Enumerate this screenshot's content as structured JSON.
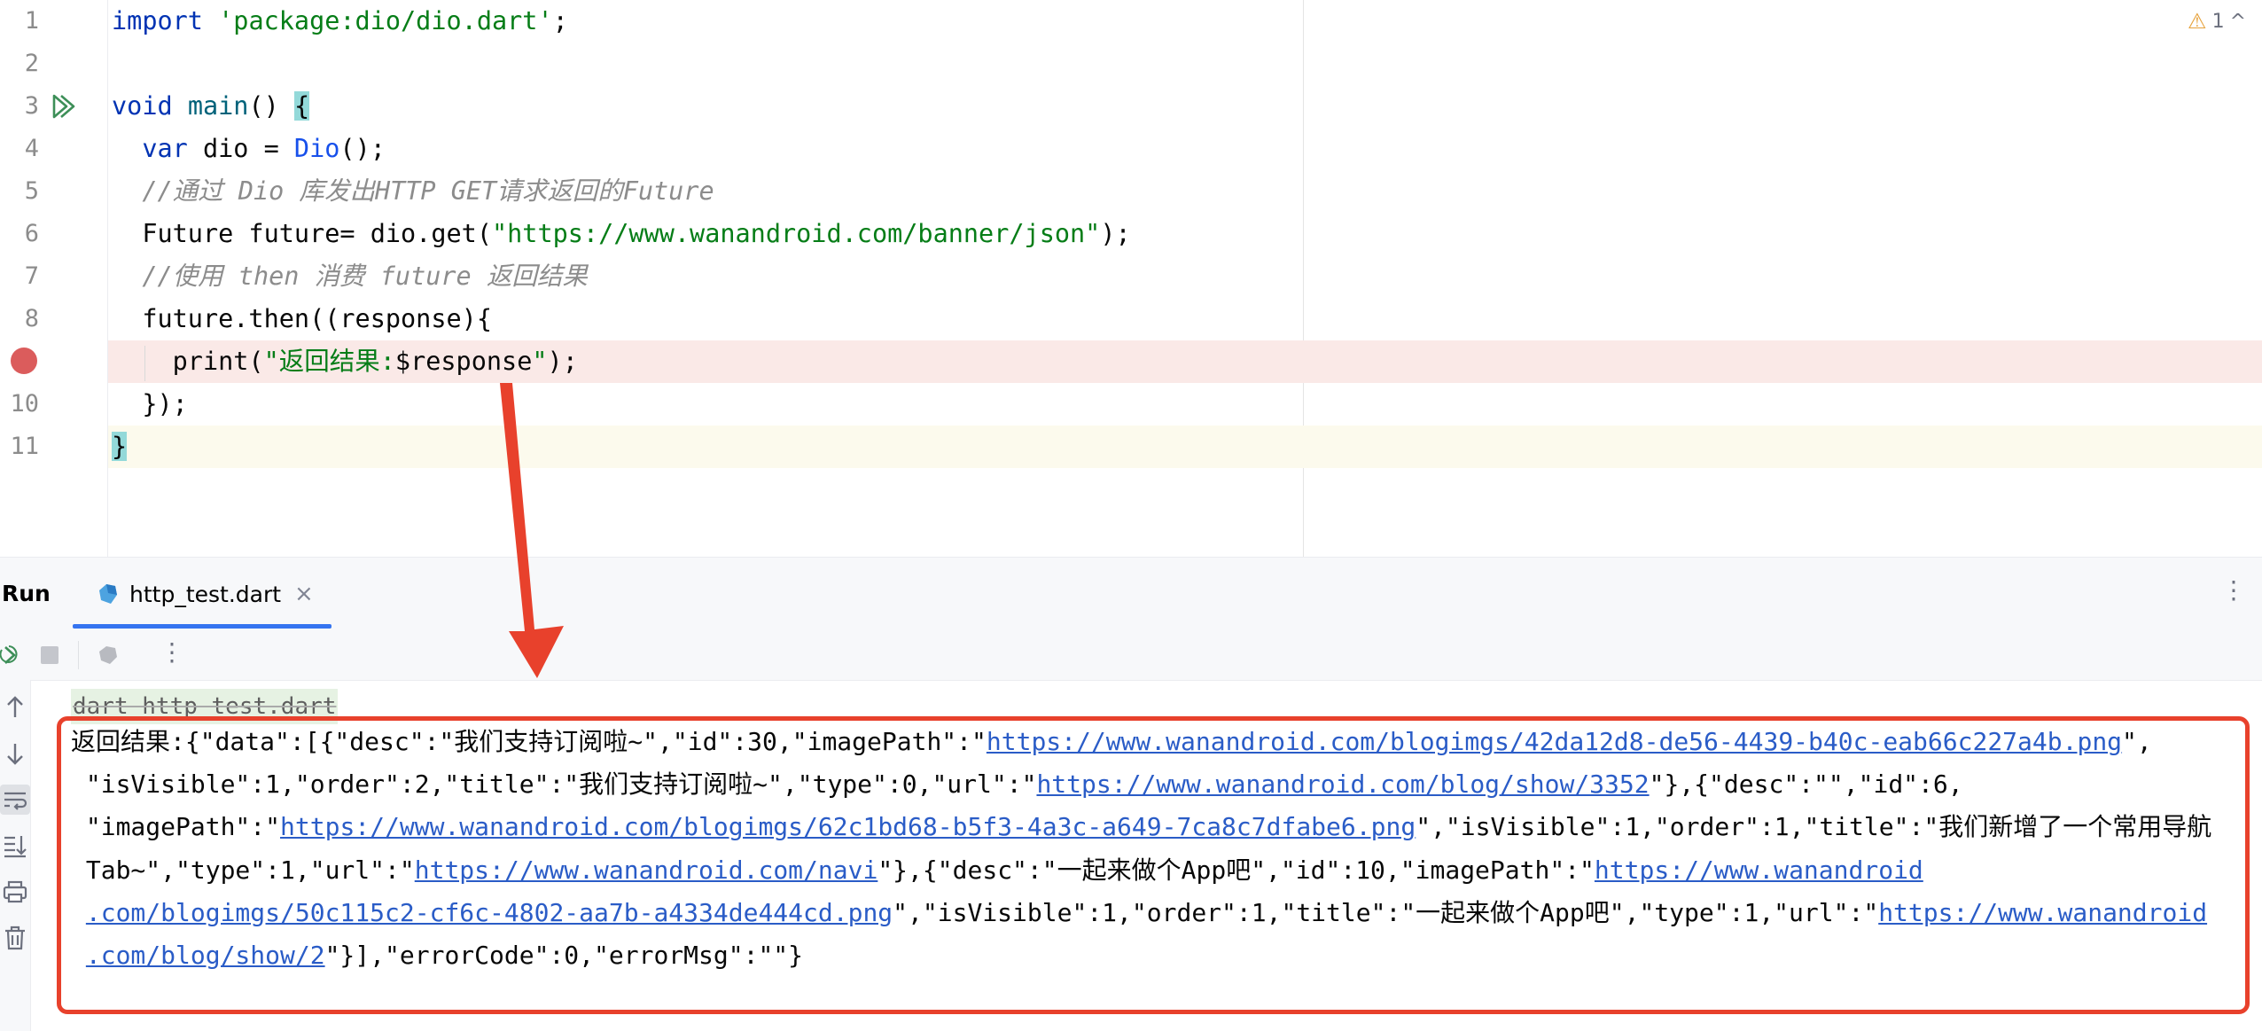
{
  "editor": {
    "lines": [
      {
        "num": "1"
      },
      {
        "num": "2"
      },
      {
        "num": "3"
      },
      {
        "num": "4"
      },
      {
        "num": "5"
      },
      {
        "num": "6"
      },
      {
        "num": "7"
      },
      {
        "num": "8"
      },
      {
        "num": ""
      },
      {
        "num": "10"
      },
      {
        "num": "11"
      }
    ],
    "code": {
      "l1_kw": "import",
      "l1_str": "'package:dio/dio.dart'",
      "l1_end": ";",
      "l3_kw": "void",
      "l3_fn": "main",
      "l3_paren": "() ",
      "l3_brace": "{",
      "l4_kw": "var",
      "l4_mid": " dio = ",
      "l4_cls": "Dio",
      "l4_end": "();",
      "l5_cmt": "//通过 Dio 库发出HTTP GET请求返回的Future",
      "l6_a": "Future future= dio.get(",
      "l6_str": "\"https://www.wanandroid.com/banner/json\"",
      "l6_end": ");",
      "l7_cmt": "//使用 then 消费 future 返回结果",
      "l8": "future.then((response){",
      "l9_a": "print(",
      "l9_str1": "\"返回结果:",
      "l9_var": "$response",
      "l9_str2": "\"",
      "l9_end": ");",
      "l10": "});",
      "l11": "}"
    },
    "inspection": {
      "warnings": "1",
      "chevron": "^"
    }
  },
  "run_panel": {
    "title": "Run",
    "tab_label": "http_test.dart",
    "tab_close": "×",
    "more": "⋮",
    "toolbar_more": "⋮",
    "console_header": "dart http_test.dart",
    "output": {
      "l1_a": "返回结果:{\"data\":[{\"desc\":\"我们支持订阅啦~\",\"id\":30,\"imagePath\":\"",
      "l1_link": "https://www.wanandroid.com/blogimgs/42da12d8-de56-4439-b40c-eab66c227a4b.png",
      "l1_b": "\",",
      "l2_a": " \"isVisible\":1,\"order\":2,\"title\":\"我们支持订阅啦~\",\"type\":0,\"url\":\"",
      "l2_link": "https://www.wanandroid.com/blog/show/3352",
      "l2_b": "\"},{\"desc\":\"\",\"id\":6,",
      "l3_a": " \"imagePath\":\"",
      "l3_link": "https://www.wanandroid.com/blogimgs/62c1bd68-b5f3-4a3c-a649-7ca8c7dfabe6.png",
      "l3_b": "\",\"isVisible\":1,\"order\":1,\"title\":\"我们新增了一个常用导航",
      "l4_a": " Tab~\",\"type\":1,\"url\":\"",
      "l4_link": "https://www.wanandroid.com/navi",
      "l4_b": "\"},{\"desc\":\"一起来做个App吧\",\"id\":10,\"imagePath\":\"",
      "l4_link2": "https://www.wanandroid",
      "l5_link": ".com/blogimgs/50c115c2-cf6c-4802-aa7b-a4334de444cd.png",
      "l5_b": "\",\"isVisible\":1,\"order\":1,\"title\":\"一起来做个App吧\",\"type\":1,\"url\":\"",
      "l5_link2": "https://www.wanandroid",
      "l6_link": ".com/blog/show/2",
      "l6_b": "\"}],\"errorCode\":0,\"errorMsg\":\"\"}"
    }
  },
  "colors": {
    "keyword": "#0033b3",
    "string": "#067d17",
    "comment": "#8c8c8c",
    "class": "#1750eb",
    "link": "#2a5cc7",
    "annotation_red": "#e8412c",
    "breakpoint": "#db5c5c",
    "tab_underline": "#3574f0"
  },
  "icons": [
    "run-gutter-icon",
    "breakpoint-icon",
    "warning-icon",
    "dart-file-icon",
    "close-icon",
    "more-vertical-icon",
    "rerun-icon",
    "stop-icon",
    "debug-icon",
    "scroll-up-icon",
    "scroll-down-icon",
    "soft-wrap-icon",
    "scroll-to-end-icon",
    "print-icon",
    "trash-icon",
    "annotation-arrow"
  ]
}
